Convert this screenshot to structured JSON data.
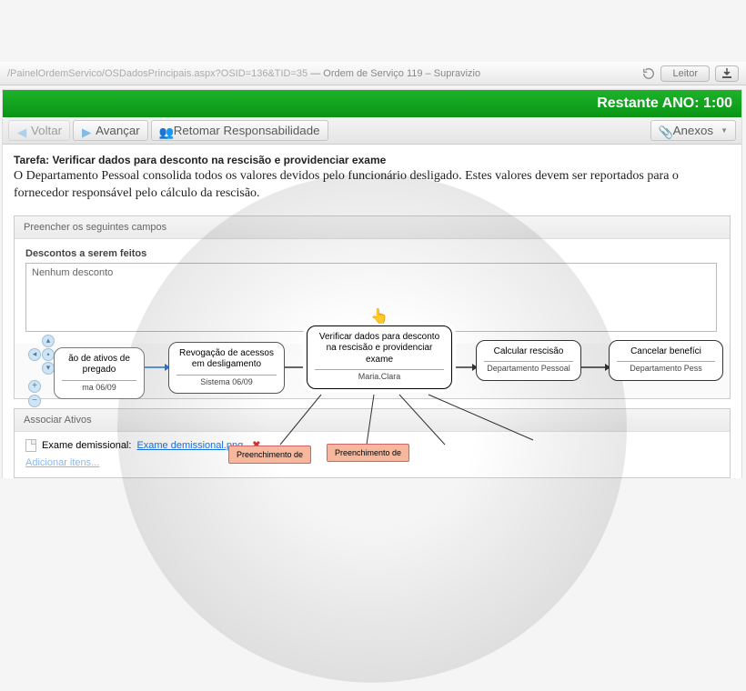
{
  "browser": {
    "url_path": "/PainelOrdemServico/OSDadosPrincipais.aspx?OSID=136&TID=35",
    "page_title": " — Ordem de Serviço 119 – Supravizio",
    "leitor_label": "Leitor"
  },
  "banner": "Restante ANO: 1:00",
  "toolbar": {
    "voltar": "Voltar",
    "avancar": "Avançar",
    "retomar": "Retomar Responsabilidade",
    "anexos": "Anexos"
  },
  "task": {
    "prefix": "Tarefa:",
    "title": "Verificar dados para desconto na rescisão e providenciar exame",
    "desc": "O Departamento Pessoal consolida todos os valores devidos pelo funcionário desligado. Estes valores devem ser reportados para o fornecedor responsável pelo cálculo da rescisão."
  },
  "fields_panel": {
    "header": "Preencher os seguintes campos",
    "label": "Descontos a serem feitos",
    "value": "Nenhum desconto"
  },
  "assets_panel": {
    "header": "Associar Ativos",
    "item_label": "Exame demissional:",
    "item_file": "Exame demissional.png",
    "add_link": "Adicionar itens..."
  },
  "flow": {
    "n1": {
      "title": "ão de ativos de\npregado",
      "owner": "ma 06/09"
    },
    "n2": {
      "title": "Revogação de acessos em desligamento",
      "owner": "Sistema 06/09"
    },
    "n3": {
      "title": "Verificar dados para desconto na rescisão e providenciar exame",
      "owner": "Maria.Clara"
    },
    "n4": {
      "title": "Calcular rescisão",
      "owner": "Departamento Pessoal"
    },
    "n5": {
      "title": "Cancelar benefíci",
      "owner": "Departamento Pess"
    },
    "s1": "Preenchimento de",
    "s2": "Preenchimento de"
  }
}
